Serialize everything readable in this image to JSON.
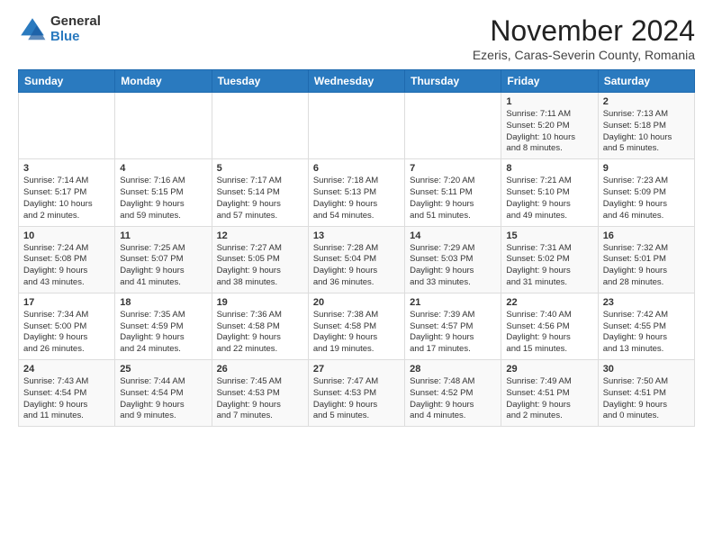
{
  "logo": {
    "general": "General",
    "blue": "Blue"
  },
  "title": "November 2024",
  "location": "Ezeris, Caras-Severin County, Romania",
  "days_header": [
    "Sunday",
    "Monday",
    "Tuesday",
    "Wednesday",
    "Thursday",
    "Friday",
    "Saturday"
  ],
  "weeks": [
    {
      "row_class": "row-odd",
      "days": [
        {
          "num": "",
          "info": ""
        },
        {
          "num": "",
          "info": ""
        },
        {
          "num": "",
          "info": ""
        },
        {
          "num": "",
          "info": ""
        },
        {
          "num": "",
          "info": ""
        },
        {
          "num": "1",
          "info": "Sunrise: 7:11 AM\nSunset: 5:20 PM\nDaylight: 10 hours\nand 8 minutes."
        },
        {
          "num": "2",
          "info": "Sunrise: 7:13 AM\nSunset: 5:18 PM\nDaylight: 10 hours\nand 5 minutes."
        }
      ]
    },
    {
      "row_class": "row-even",
      "days": [
        {
          "num": "3",
          "info": "Sunrise: 7:14 AM\nSunset: 5:17 PM\nDaylight: 10 hours\nand 2 minutes."
        },
        {
          "num": "4",
          "info": "Sunrise: 7:16 AM\nSunset: 5:15 PM\nDaylight: 9 hours\nand 59 minutes."
        },
        {
          "num": "5",
          "info": "Sunrise: 7:17 AM\nSunset: 5:14 PM\nDaylight: 9 hours\nand 57 minutes."
        },
        {
          "num": "6",
          "info": "Sunrise: 7:18 AM\nSunset: 5:13 PM\nDaylight: 9 hours\nand 54 minutes."
        },
        {
          "num": "7",
          "info": "Sunrise: 7:20 AM\nSunset: 5:11 PM\nDaylight: 9 hours\nand 51 minutes."
        },
        {
          "num": "8",
          "info": "Sunrise: 7:21 AM\nSunset: 5:10 PM\nDaylight: 9 hours\nand 49 minutes."
        },
        {
          "num": "9",
          "info": "Sunrise: 7:23 AM\nSunset: 5:09 PM\nDaylight: 9 hours\nand 46 minutes."
        }
      ]
    },
    {
      "row_class": "row-odd",
      "days": [
        {
          "num": "10",
          "info": "Sunrise: 7:24 AM\nSunset: 5:08 PM\nDaylight: 9 hours\nand 43 minutes."
        },
        {
          "num": "11",
          "info": "Sunrise: 7:25 AM\nSunset: 5:07 PM\nDaylight: 9 hours\nand 41 minutes."
        },
        {
          "num": "12",
          "info": "Sunrise: 7:27 AM\nSunset: 5:05 PM\nDaylight: 9 hours\nand 38 minutes."
        },
        {
          "num": "13",
          "info": "Sunrise: 7:28 AM\nSunset: 5:04 PM\nDaylight: 9 hours\nand 36 minutes."
        },
        {
          "num": "14",
          "info": "Sunrise: 7:29 AM\nSunset: 5:03 PM\nDaylight: 9 hours\nand 33 minutes."
        },
        {
          "num": "15",
          "info": "Sunrise: 7:31 AM\nSunset: 5:02 PM\nDaylight: 9 hours\nand 31 minutes."
        },
        {
          "num": "16",
          "info": "Sunrise: 7:32 AM\nSunset: 5:01 PM\nDaylight: 9 hours\nand 28 minutes."
        }
      ]
    },
    {
      "row_class": "row-even",
      "days": [
        {
          "num": "17",
          "info": "Sunrise: 7:34 AM\nSunset: 5:00 PM\nDaylight: 9 hours\nand 26 minutes."
        },
        {
          "num": "18",
          "info": "Sunrise: 7:35 AM\nSunset: 4:59 PM\nDaylight: 9 hours\nand 24 minutes."
        },
        {
          "num": "19",
          "info": "Sunrise: 7:36 AM\nSunset: 4:58 PM\nDaylight: 9 hours\nand 22 minutes."
        },
        {
          "num": "20",
          "info": "Sunrise: 7:38 AM\nSunset: 4:58 PM\nDaylight: 9 hours\nand 19 minutes."
        },
        {
          "num": "21",
          "info": "Sunrise: 7:39 AM\nSunset: 4:57 PM\nDaylight: 9 hours\nand 17 minutes."
        },
        {
          "num": "22",
          "info": "Sunrise: 7:40 AM\nSunset: 4:56 PM\nDaylight: 9 hours\nand 15 minutes."
        },
        {
          "num": "23",
          "info": "Sunrise: 7:42 AM\nSunset: 4:55 PM\nDaylight: 9 hours\nand 13 minutes."
        }
      ]
    },
    {
      "row_class": "row-odd",
      "days": [
        {
          "num": "24",
          "info": "Sunrise: 7:43 AM\nSunset: 4:54 PM\nDaylight: 9 hours\nand 11 minutes."
        },
        {
          "num": "25",
          "info": "Sunrise: 7:44 AM\nSunset: 4:54 PM\nDaylight: 9 hours\nand 9 minutes."
        },
        {
          "num": "26",
          "info": "Sunrise: 7:45 AM\nSunset: 4:53 PM\nDaylight: 9 hours\nand 7 minutes."
        },
        {
          "num": "27",
          "info": "Sunrise: 7:47 AM\nSunset: 4:53 PM\nDaylight: 9 hours\nand 5 minutes."
        },
        {
          "num": "28",
          "info": "Sunrise: 7:48 AM\nSunset: 4:52 PM\nDaylight: 9 hours\nand 4 minutes."
        },
        {
          "num": "29",
          "info": "Sunrise: 7:49 AM\nSunset: 4:51 PM\nDaylight: 9 hours\nand 2 minutes."
        },
        {
          "num": "30",
          "info": "Sunrise: 7:50 AM\nSunset: 4:51 PM\nDaylight: 9 hours\nand 0 minutes."
        }
      ]
    }
  ]
}
